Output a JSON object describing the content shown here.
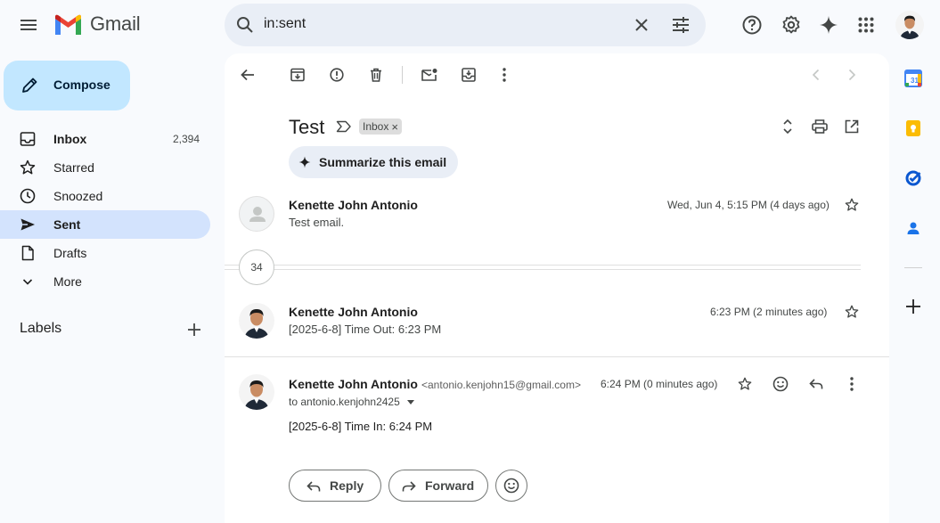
{
  "app": {
    "name": "Gmail"
  },
  "search": {
    "query": "in:sent"
  },
  "compose": {
    "label": "Compose"
  },
  "nav": [
    {
      "label": "Inbox",
      "count": "2,394"
    },
    {
      "label": "Starred"
    },
    {
      "label": "Snoozed"
    },
    {
      "label": "Sent"
    },
    {
      "label": "Drafts"
    },
    {
      "label": "More"
    }
  ],
  "labels_section": {
    "title": "Labels"
  },
  "thread": {
    "subject": "Test",
    "label_chip": "Inbox",
    "chip_close": "×",
    "summarize_label": "Summarize this email",
    "collapsed_count": "34",
    "messages": [
      {
        "sender": "Kenette John Antonio",
        "snippet": "Test email.",
        "date": "Wed, Jun 4, 5:15 PM (4 days ago)"
      },
      {
        "sender": "Kenette John Antonio",
        "snippet": "[2025-6-8] Time Out: 6:23 PM",
        "date": "6:23 PM (2 minutes ago)"
      },
      {
        "sender": "Kenette John Antonio",
        "email": "<antonio.kenjohn15@gmail.com>",
        "to": "to antonio.kenjohn2425",
        "date": "6:24 PM (0 minutes ago)",
        "body": "[2025-6-8] Time In: 6:24 PM"
      }
    ]
  },
  "actions": {
    "reply": "Reply",
    "forward": "Forward"
  },
  "colors": {
    "accent": "#0b57d0",
    "active_nav": "#d3e3fd",
    "compose_bg": "#c2e7ff"
  }
}
